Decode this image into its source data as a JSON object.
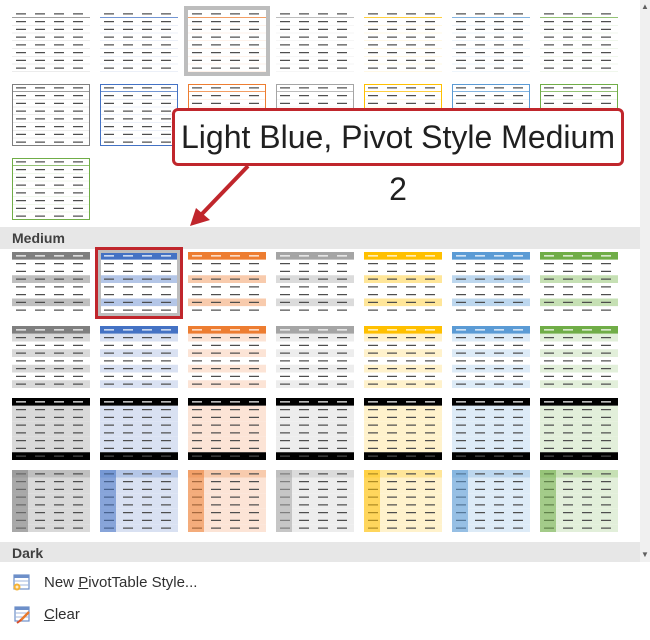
{
  "sections": {
    "medium": "Medium",
    "dark": "Dark"
  },
  "callout": {
    "text": "Light Blue, Pivot Style Medium 2"
  },
  "menu": {
    "new_style": {
      "prefix": "New ",
      "accel": "P",
      "suffix": "ivotTable Style..."
    },
    "clear": {
      "accel": "C",
      "suffix": "lear"
    }
  },
  "colors": {
    "gray": "#7f7f7f",
    "blue": "#4472c4",
    "orange": "#ed7d31",
    "neutral": "#a5a5a5",
    "gold": "#ffc000",
    "sky": "#5b9bd5",
    "green": "#70ad47",
    "highlight": "#c0262c"
  },
  "icons": {
    "new_style": "new-pivot-style-icon",
    "clear": "clear-table-icon",
    "scroll_up": "scroll-up-arrow-icon",
    "scroll_down": "scroll-down-arrow-icon"
  }
}
